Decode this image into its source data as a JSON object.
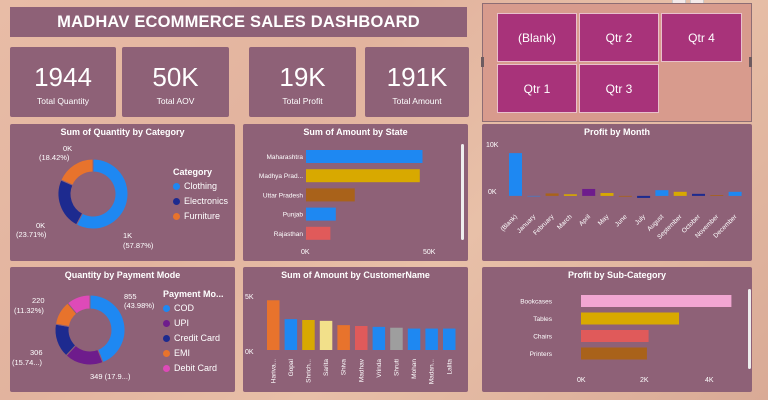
{
  "header": {
    "title": "MADHAV ECOMMERCE SALES DASHBOARD"
  },
  "kpis": [
    {
      "value": "1944",
      "label": "Total Quantity"
    },
    {
      "value": "50K",
      "label": "Total AOV"
    },
    {
      "value": "19K",
      "label": "Total Profit"
    },
    {
      "value": "191K",
      "label": "Total  Amount"
    }
  ],
  "slicer": {
    "buttons": [
      "(Blank)",
      "Qtr 2",
      "Qtr 4",
      "Qtr 1",
      "Qtr 3"
    ]
  },
  "colors": {
    "panel": "#8e6177",
    "blue": "#1e88f2",
    "navy": "#1d2a8f",
    "orange": "#e8732c",
    "purple": "#6e1c8c",
    "pink": "#de4ab8",
    "gold": "#d8a900",
    "brown": "#a9621a",
    "red": "#e05a5a",
    "slicer_button": "#a8337a"
  },
  "charts": {
    "category": {
      "title": "Sum of Quantity by Category",
      "legend_title": "Category",
      "labels": [
        {
          "top": "0K",
          "bottom": "(18.42%)"
        },
        {
          "top": "0K",
          "bottom": "(23.71%)"
        },
        {
          "top": "1K",
          "bottom": "(57.87%)"
        }
      ]
    },
    "state": {
      "title": "Sum of Amount by State",
      "ticks": [
        "0K",
        "50K"
      ]
    },
    "month": {
      "title": "Profit by Month",
      "ticks": [
        "10K",
        "0K"
      ]
    },
    "payment": {
      "title": "Quantity by Payment Mode",
      "legend_title": "Payment Mo...",
      "labels": [
        {
          "top": "855",
          "bottom": "(43.98%)"
        },
        {
          "top": "220",
          "bottom": "(11.32%)"
        },
        {
          "top": "306",
          "bottom": "(15.74...)"
        },
        {
          "top": "349 (17.9...)",
          "bottom": ""
        }
      ]
    },
    "customer": {
      "title": "Sum of Amount by CustomerName",
      "ticks": [
        "5K",
        "0K"
      ]
    },
    "subcategory": {
      "title": "Profit by Sub-Category",
      "ticks": [
        "0K",
        "2K",
        "4K"
      ]
    }
  },
  "chart_data": [
    {
      "type": "pie",
      "title": "Sum of Quantity by Category",
      "categories": [
        "Clothing",
        "Electronics",
        "Furniture"
      ],
      "values": [
        57.87,
        23.71,
        18.42
      ],
      "colors": [
        "#1e88f2",
        "#1d2a8f",
        "#e8732c"
      ],
      "legend": "right"
    },
    {
      "type": "bar",
      "orientation": "horizontal",
      "title": "Sum of Amount by State",
      "categories": [
        "Maharashtra",
        "Madhya Prad...",
        "Uttar Pradesh",
        "Punjab",
        "Rajasthan"
      ],
      "values": [
        43000,
        42000,
        18000,
        11000,
        9000
      ],
      "colors": [
        "#1e88f2",
        "#d8a900",
        "#a9621a",
        "#1e88f2",
        "#e05a5a"
      ],
      "xlim": [
        0,
        55000
      ]
    },
    {
      "type": "bar",
      "title": "Profit by Month",
      "categories": [
        "(Blank)",
        "January",
        "February",
        "March",
        "April",
        "May",
        "June",
        "July",
        "August",
        "September",
        "October",
        "November",
        "December"
      ],
      "values": [
        10500,
        0,
        600,
        400,
        1700,
        700,
        -200,
        -500,
        1400,
        1000,
        500,
        200,
        1000
      ],
      "colors": [
        "#1e88f2",
        "#1e88f2",
        "#a9621a",
        "#d8a900",
        "#6e1c8c",
        "#d8a900",
        "#a9621a",
        "#1d2a8f",
        "#1e88f2",
        "#d8a900",
        "#1d2a8f",
        "#a9621a",
        "#1e88f2"
      ],
      "ylim": [
        -1500,
        12000
      ]
    },
    {
      "type": "pie",
      "title": "Quantity by Payment Mode",
      "categories": [
        "COD",
        "UPI",
        "Credit Card",
        "EMI",
        "Debit Card"
      ],
      "values": [
        855,
        349,
        306,
        220,
        214
      ],
      "colors": [
        "#1e88f2",
        "#6e1c8c",
        "#1d2a8f",
        "#e8732c",
        "#de4ab8"
      ],
      "legend": "right"
    },
    {
      "type": "bar",
      "title": "Sum of Amount by CustomerName",
      "categories": [
        "Hariva...",
        "Gopal",
        "Shrich...",
        "Sarita",
        "Shiva",
        "Madhav",
        "Vrinda",
        "Shruti",
        "Mohan",
        "Madan...",
        "Lalita"
      ],
      "values": [
        5800,
        3600,
        3500,
        3400,
        2900,
        2800,
        2700,
        2600,
        2500,
        2500,
        2500
      ],
      "colors": [
        "#e8732c",
        "#1e88f2",
        "#d8a900",
        "#f2e08a",
        "#e8732c",
        "#e05a5a",
        "#1e88f2",
        "#9e9e9e",
        "#1e88f2",
        "#1e88f2",
        "#1e88f2"
      ],
      "ylim": [
        0,
        7000
      ]
    },
    {
      "type": "bar",
      "orientation": "horizontal",
      "title": "Profit by Sub-Category",
      "categories": [
        "Bookcases",
        "Tables",
        "Chairs",
        "Printers"
      ],
      "values": [
        4450,
        2900,
        2000,
        1950
      ],
      "colors": [
        "#f2a6d2",
        "#d8a900",
        "#e05a5a",
        "#a9621a"
      ],
      "xlim": [
        0,
        5000
      ]
    }
  ]
}
